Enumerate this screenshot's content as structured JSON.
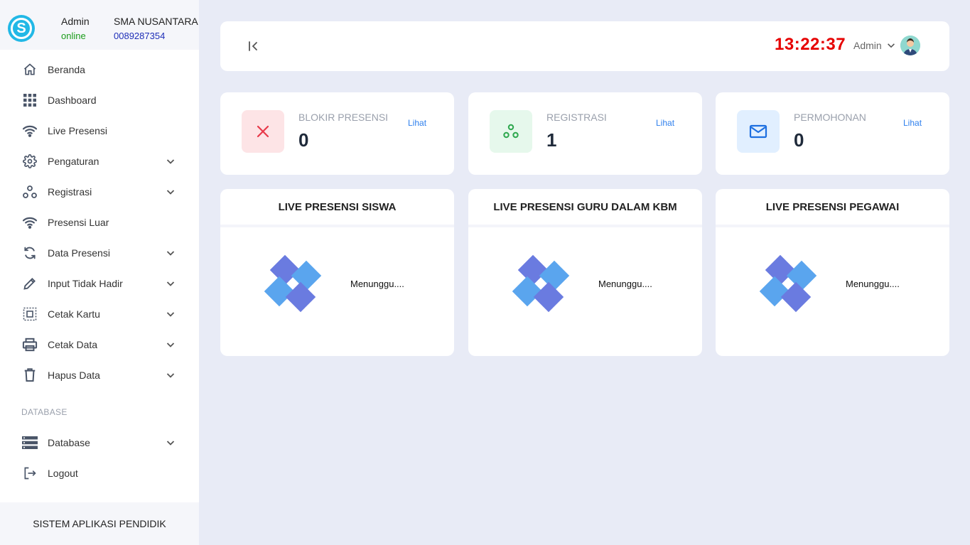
{
  "user": {
    "name": "Admin",
    "status": "online"
  },
  "school": {
    "name": "SMA NUSANTARA",
    "npsn": "0089287354"
  },
  "menu": [
    {
      "label": "Beranda",
      "icon": "home-icon",
      "has_submenu": false
    },
    {
      "label": "Dashboard",
      "icon": "grid-icon",
      "has_submenu": false
    },
    {
      "label": "Live Presensi",
      "icon": "wifi-icon",
      "has_submenu": false
    },
    {
      "label": "Pengaturan",
      "icon": "gear-icon",
      "has_submenu": true
    },
    {
      "label": "Registrasi",
      "icon": "circles-icon",
      "has_submenu": true
    },
    {
      "label": "Presensi Luar",
      "icon": "wifi-icon",
      "has_submenu": false
    },
    {
      "label": "Data Presensi",
      "icon": "sync-icon",
      "has_submenu": true
    },
    {
      "label": "Input Tidak Hadir",
      "icon": "pencil-icon",
      "has_submenu": true
    },
    {
      "label": "Cetak Kartu",
      "icon": "card-icon",
      "has_submenu": true
    },
    {
      "label": "Cetak Data",
      "icon": "printer-icon",
      "has_submenu": true
    },
    {
      "label": "Hapus Data",
      "icon": "trash-icon",
      "has_submenu": true
    }
  ],
  "menu_section": "DATABASE",
  "menu2": [
    {
      "label": "Database",
      "icon": "database-icon",
      "has_submenu": true
    },
    {
      "label": "Logout",
      "icon": "logout-icon",
      "has_submenu": false
    }
  ],
  "footer": "SISTEM APLIKASI PENDIDIK",
  "topbar": {
    "clock": "13:22:37",
    "user_label": "Admin"
  },
  "stats": [
    {
      "title": "BLOKIR PRESENSI",
      "value": "0",
      "link": "Lihat",
      "icon": "close-icon",
      "bg": "#fde4e6",
      "color": "#e8394a"
    },
    {
      "title": "REGISTRASI",
      "value": "1",
      "link": "Lihat",
      "icon": "circles-icon",
      "bg": "#e6f8ec",
      "color": "#2fa84f"
    },
    {
      "title": "PERMOHONAN",
      "value": "0",
      "link": "Lihat",
      "icon": "mail-icon",
      "bg": "#e1efff",
      "color": "#1d6fe0"
    }
  ],
  "live": [
    {
      "title": "LIVE PRESENSI SISWA",
      "status": "Menunggu...."
    },
    {
      "title": "LIVE PRESENSI GURU DALAM KBM",
      "status": "Menunggu...."
    },
    {
      "title": "LIVE PRESENSI PEGAWAI",
      "status": "Menunggu...."
    }
  ]
}
